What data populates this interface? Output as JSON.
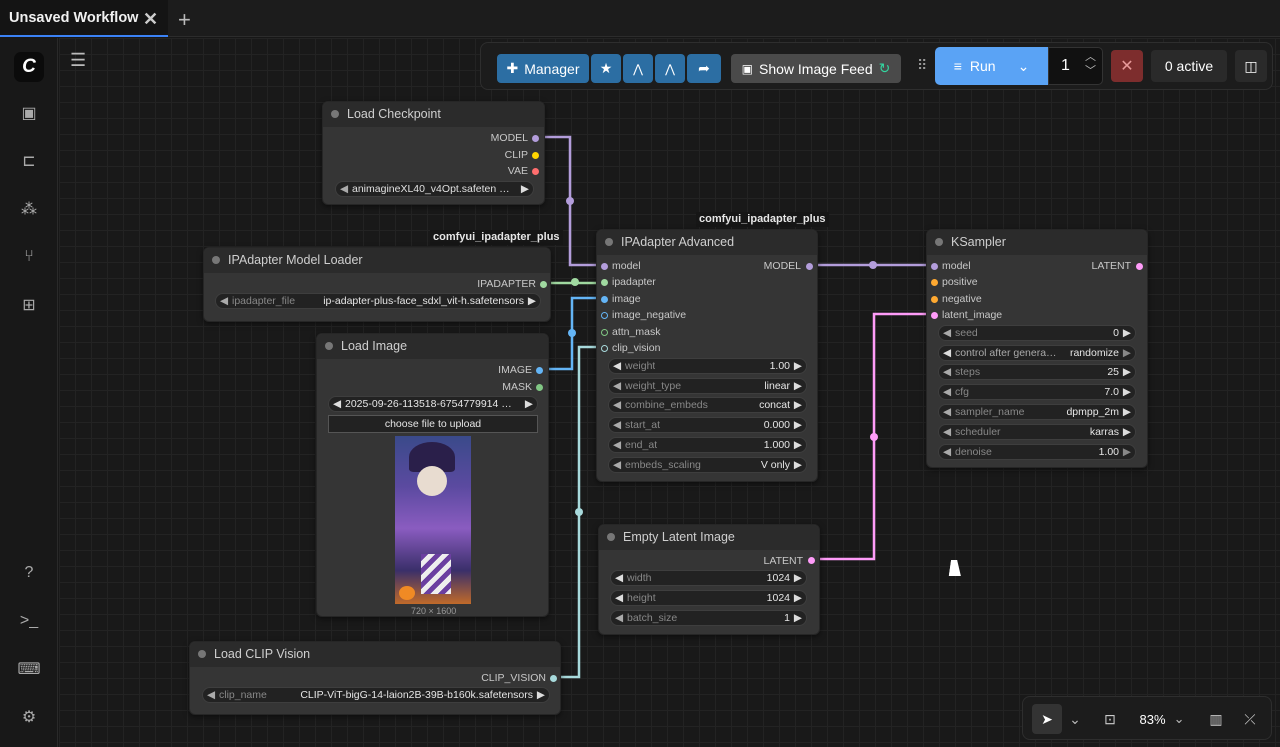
{
  "tab": {
    "title": "Unsaved Workflow"
  },
  "toolbar": {
    "manager": "Manager",
    "show_image_feed": "Show Image Feed",
    "run": "Run",
    "batch_count": "1",
    "active": "0 active"
  },
  "nodes": {
    "load_checkpoint": {
      "title": "Load Checkpoint",
      "outputs": [
        "MODEL",
        "CLIP",
        "VAE"
      ],
      "ckpt": "animagineXL40_v4Opt.safeten …"
    },
    "ipadapter_loader": {
      "title": "IPAdapter Model Loader",
      "pack": "comfyui_ipadapter_plus",
      "output": "IPADAPTER",
      "widget_name": "ipadapter_file",
      "widget_value": "ip-adapter-plus-face_sdxl_vit-h.safetensors"
    },
    "load_image": {
      "title": "Load Image",
      "outputs": [
        "IMAGE",
        "MASK"
      ],
      "file": "2025-09-26-113518-6754779914 …",
      "upload": "choose file to upload",
      "dims": "720 × 1600"
    },
    "load_clip_vision": {
      "title": "Load CLIP Vision",
      "output": "CLIP_VISION",
      "widget_name": "clip_name",
      "widget_value": "CLIP-ViT-bigG-14-laion2B-39B-b160k.safetensors"
    },
    "ipadapter_advanced": {
      "title": "IPAdapter Advanced",
      "pack": "comfyui_ipadapter_plus",
      "inputs": [
        "model",
        "ipadapter",
        "image",
        "image_negative",
        "attn_mask",
        "clip_vision"
      ],
      "output": "MODEL",
      "widgets": [
        {
          "name": "weight",
          "value": "1.00"
        },
        {
          "name": "weight_type",
          "value": "linear"
        },
        {
          "name": "combine_embeds",
          "value": "concat"
        },
        {
          "name": "start_at",
          "value": "0.000"
        },
        {
          "name": "end_at",
          "value": "1.000"
        },
        {
          "name": "embeds_scaling",
          "value": "V only"
        }
      ]
    },
    "empty_latent": {
      "title": "Empty Latent Image",
      "output": "LATENT",
      "widgets": [
        {
          "name": "width",
          "value": "1024"
        },
        {
          "name": "height",
          "value": "1024"
        },
        {
          "name": "batch_size",
          "value": "1"
        }
      ]
    },
    "ksampler": {
      "title": "KSampler",
      "inputs": [
        "model",
        "positive",
        "negative",
        "latent_image"
      ],
      "output": "LATENT",
      "widgets": [
        {
          "name": "seed",
          "value": "0"
        },
        {
          "name": "control after genera…",
          "value": "randomize"
        },
        {
          "name": "steps",
          "value": "25"
        },
        {
          "name": "cfg",
          "value": "7.0"
        },
        {
          "name": "sampler_name",
          "value": "dpmpp_2m"
        },
        {
          "name": "scheduler",
          "value": "karras"
        },
        {
          "name": "denoise",
          "value": "1.00"
        }
      ]
    }
  },
  "zoom": "83%",
  "colors": {
    "model": "#b39ddb",
    "clip": "#ffd500",
    "vae": "#ff6e6e",
    "ipadapter": "#a0d9a0",
    "image": "#64b5f6",
    "mask": "#81c784",
    "clip_vision": "#a8dadc",
    "latent": "#ff9cf9",
    "conditioning": "#ffa931",
    "accent": "#4a9be8"
  }
}
